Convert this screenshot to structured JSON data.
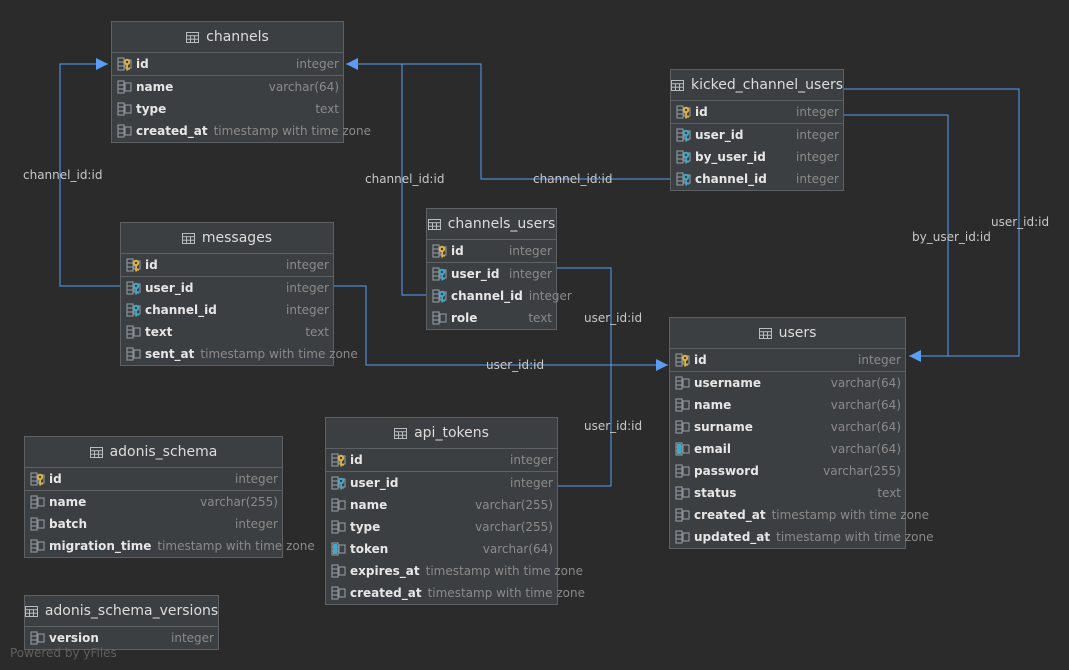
{
  "tables": [
    {
      "key": "channels",
      "title": "channels",
      "columns": [
        {
          "name": "id",
          "type": "integer",
          "kind": "pk"
        },
        {
          "name": "name",
          "type": "varchar(64)",
          "kind": "col"
        },
        {
          "name": "type",
          "type": "text",
          "kind": "col"
        },
        {
          "name": "created_at",
          "type": "timestamp with time zone",
          "kind": "col"
        }
      ]
    },
    {
      "key": "kicked_channel_users",
      "title": "kicked_channel_users",
      "columns": [
        {
          "name": "id",
          "type": "integer",
          "kind": "pk"
        },
        {
          "name": "user_id",
          "type": "integer",
          "kind": "fk"
        },
        {
          "name": "by_user_id",
          "type": "integer",
          "kind": "fk"
        },
        {
          "name": "channel_id",
          "type": "integer",
          "kind": "fk"
        }
      ]
    },
    {
      "key": "messages",
      "title": "messages",
      "columns": [
        {
          "name": "id",
          "type": "integer",
          "kind": "pk"
        },
        {
          "name": "user_id",
          "type": "integer",
          "kind": "fk"
        },
        {
          "name": "channel_id",
          "type": "integer",
          "kind": "fk"
        },
        {
          "name": "text",
          "type": "text",
          "kind": "col"
        },
        {
          "name": "sent_at",
          "type": "timestamp with time zone",
          "kind": "col"
        }
      ]
    },
    {
      "key": "channels_users",
      "title": "channels_users",
      "columns": [
        {
          "name": "id",
          "type": "integer",
          "kind": "pk"
        },
        {
          "name": "user_id",
          "type": "integer",
          "kind": "fk"
        },
        {
          "name": "channel_id",
          "type": "integer",
          "kind": "fk"
        },
        {
          "name": "role",
          "type": "text",
          "kind": "col"
        }
      ]
    },
    {
      "key": "users",
      "title": "users",
      "columns": [
        {
          "name": "id",
          "type": "integer",
          "kind": "pk"
        },
        {
          "name": "username",
          "type": "varchar(64)",
          "kind": "col"
        },
        {
          "name": "name",
          "type": "varchar(64)",
          "kind": "col"
        },
        {
          "name": "surname",
          "type": "varchar(64)",
          "kind": "col"
        },
        {
          "name": "email",
          "type": "varchar(64)",
          "kind": "unique"
        },
        {
          "name": "password",
          "type": "varchar(255)",
          "kind": "col"
        },
        {
          "name": "status",
          "type": "text",
          "kind": "col"
        },
        {
          "name": "created_at",
          "type": "timestamp with time zone",
          "kind": "col"
        },
        {
          "name": "updated_at",
          "type": "timestamp with time zone",
          "kind": "col"
        }
      ]
    },
    {
      "key": "adonis_schema",
      "title": "adonis_schema",
      "columns": [
        {
          "name": "id",
          "type": "integer",
          "kind": "pk"
        },
        {
          "name": "name",
          "type": "varchar(255)",
          "kind": "col"
        },
        {
          "name": "batch",
          "type": "integer",
          "kind": "col"
        },
        {
          "name": "migration_time",
          "type": "timestamp with time zone",
          "kind": "col"
        }
      ]
    },
    {
      "key": "api_tokens",
      "title": "api_tokens",
      "columns": [
        {
          "name": "id",
          "type": "integer",
          "kind": "pk"
        },
        {
          "name": "user_id",
          "type": "integer",
          "kind": "fk"
        },
        {
          "name": "name",
          "type": "varchar(255)",
          "kind": "col"
        },
        {
          "name": "type",
          "type": "varchar(255)",
          "kind": "col"
        },
        {
          "name": "token",
          "type": "varchar(64)",
          "kind": "unique"
        },
        {
          "name": "expires_at",
          "type": "timestamp with time zone",
          "kind": "col"
        },
        {
          "name": "created_at",
          "type": "timestamp with time zone",
          "kind": "col"
        }
      ]
    },
    {
      "key": "adonis_schema_versions",
      "title": "adonis_schema_versions",
      "columns": [
        {
          "name": "version",
          "type": "integer",
          "kind": "col"
        }
      ]
    }
  ],
  "relations": [
    {
      "key": "messages_channel",
      "label": "channel_id:id"
    },
    {
      "key": "channels_users_channel",
      "label": "channel_id:id"
    },
    {
      "key": "kicked_channel",
      "label": "channel_id:id"
    },
    {
      "key": "kicked_by_user",
      "label": "by_user_id:id"
    },
    {
      "key": "kicked_user",
      "label": "user_id:id"
    },
    {
      "key": "channels_users_user",
      "label": "user_id:id"
    },
    {
      "key": "messages_user",
      "label": "user_id:id"
    },
    {
      "key": "api_tokens_user",
      "label": "user_id:id"
    }
  ],
  "footer": "Powered by yFiles",
  "colors": {
    "background": "#2b2b2b",
    "table_fill": "#3c3f41",
    "table_border": "#5e6163",
    "edge": "#5a9df5",
    "edge_label": "#c8c8c8",
    "key_gold": "#e2b33c",
    "column_icon": "#8a9299",
    "foreign_key_accent": "#3fa9c9"
  }
}
